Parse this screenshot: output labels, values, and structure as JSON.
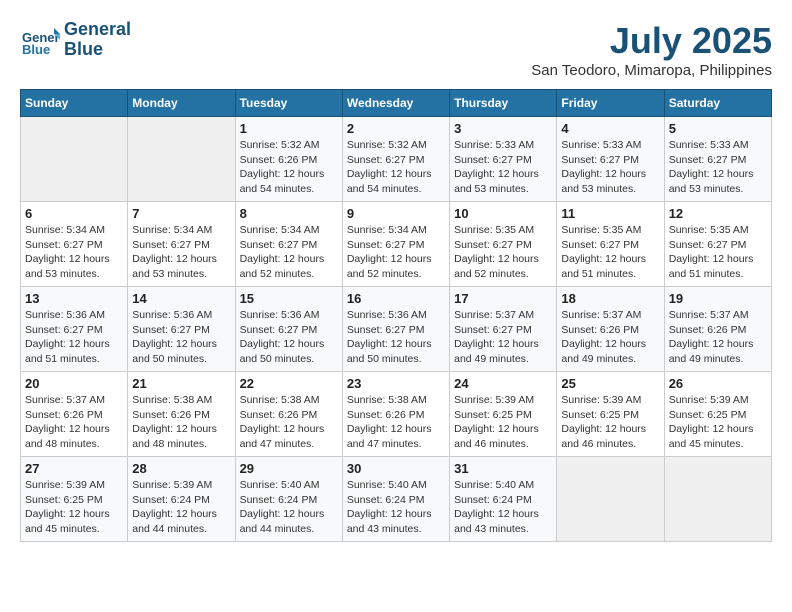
{
  "header": {
    "logo_line1": "General",
    "logo_line2": "Blue",
    "month_title": "July 2025",
    "subtitle": "San Teodoro, Mimaropa, Philippines"
  },
  "days_of_week": [
    "Sunday",
    "Monday",
    "Tuesday",
    "Wednesday",
    "Thursday",
    "Friday",
    "Saturday"
  ],
  "weeks": [
    [
      {
        "day": "",
        "info": ""
      },
      {
        "day": "",
        "info": ""
      },
      {
        "day": "1",
        "info": "Sunrise: 5:32 AM\nSunset: 6:26 PM\nDaylight: 12 hours\nand 54 minutes."
      },
      {
        "day": "2",
        "info": "Sunrise: 5:32 AM\nSunset: 6:27 PM\nDaylight: 12 hours\nand 54 minutes."
      },
      {
        "day": "3",
        "info": "Sunrise: 5:33 AM\nSunset: 6:27 PM\nDaylight: 12 hours\nand 53 minutes."
      },
      {
        "day": "4",
        "info": "Sunrise: 5:33 AM\nSunset: 6:27 PM\nDaylight: 12 hours\nand 53 minutes."
      },
      {
        "day": "5",
        "info": "Sunrise: 5:33 AM\nSunset: 6:27 PM\nDaylight: 12 hours\nand 53 minutes."
      }
    ],
    [
      {
        "day": "6",
        "info": "Sunrise: 5:34 AM\nSunset: 6:27 PM\nDaylight: 12 hours\nand 53 minutes."
      },
      {
        "day": "7",
        "info": "Sunrise: 5:34 AM\nSunset: 6:27 PM\nDaylight: 12 hours\nand 53 minutes."
      },
      {
        "day": "8",
        "info": "Sunrise: 5:34 AM\nSunset: 6:27 PM\nDaylight: 12 hours\nand 52 minutes."
      },
      {
        "day": "9",
        "info": "Sunrise: 5:34 AM\nSunset: 6:27 PM\nDaylight: 12 hours\nand 52 minutes."
      },
      {
        "day": "10",
        "info": "Sunrise: 5:35 AM\nSunset: 6:27 PM\nDaylight: 12 hours\nand 52 minutes."
      },
      {
        "day": "11",
        "info": "Sunrise: 5:35 AM\nSunset: 6:27 PM\nDaylight: 12 hours\nand 51 minutes."
      },
      {
        "day": "12",
        "info": "Sunrise: 5:35 AM\nSunset: 6:27 PM\nDaylight: 12 hours\nand 51 minutes."
      }
    ],
    [
      {
        "day": "13",
        "info": "Sunrise: 5:36 AM\nSunset: 6:27 PM\nDaylight: 12 hours\nand 51 minutes."
      },
      {
        "day": "14",
        "info": "Sunrise: 5:36 AM\nSunset: 6:27 PM\nDaylight: 12 hours\nand 50 minutes."
      },
      {
        "day": "15",
        "info": "Sunrise: 5:36 AM\nSunset: 6:27 PM\nDaylight: 12 hours\nand 50 minutes."
      },
      {
        "day": "16",
        "info": "Sunrise: 5:36 AM\nSunset: 6:27 PM\nDaylight: 12 hours\nand 50 minutes."
      },
      {
        "day": "17",
        "info": "Sunrise: 5:37 AM\nSunset: 6:27 PM\nDaylight: 12 hours\nand 49 minutes."
      },
      {
        "day": "18",
        "info": "Sunrise: 5:37 AM\nSunset: 6:26 PM\nDaylight: 12 hours\nand 49 minutes."
      },
      {
        "day": "19",
        "info": "Sunrise: 5:37 AM\nSunset: 6:26 PM\nDaylight: 12 hours\nand 49 minutes."
      }
    ],
    [
      {
        "day": "20",
        "info": "Sunrise: 5:37 AM\nSunset: 6:26 PM\nDaylight: 12 hours\nand 48 minutes."
      },
      {
        "day": "21",
        "info": "Sunrise: 5:38 AM\nSunset: 6:26 PM\nDaylight: 12 hours\nand 48 minutes."
      },
      {
        "day": "22",
        "info": "Sunrise: 5:38 AM\nSunset: 6:26 PM\nDaylight: 12 hours\nand 47 minutes."
      },
      {
        "day": "23",
        "info": "Sunrise: 5:38 AM\nSunset: 6:26 PM\nDaylight: 12 hours\nand 47 minutes."
      },
      {
        "day": "24",
        "info": "Sunrise: 5:39 AM\nSunset: 6:25 PM\nDaylight: 12 hours\nand 46 minutes."
      },
      {
        "day": "25",
        "info": "Sunrise: 5:39 AM\nSunset: 6:25 PM\nDaylight: 12 hours\nand 46 minutes."
      },
      {
        "day": "26",
        "info": "Sunrise: 5:39 AM\nSunset: 6:25 PM\nDaylight: 12 hours\nand 45 minutes."
      }
    ],
    [
      {
        "day": "27",
        "info": "Sunrise: 5:39 AM\nSunset: 6:25 PM\nDaylight: 12 hours\nand 45 minutes."
      },
      {
        "day": "28",
        "info": "Sunrise: 5:39 AM\nSunset: 6:24 PM\nDaylight: 12 hours\nand 44 minutes."
      },
      {
        "day": "29",
        "info": "Sunrise: 5:40 AM\nSunset: 6:24 PM\nDaylight: 12 hours\nand 44 minutes."
      },
      {
        "day": "30",
        "info": "Sunrise: 5:40 AM\nSunset: 6:24 PM\nDaylight: 12 hours\nand 43 minutes."
      },
      {
        "day": "31",
        "info": "Sunrise: 5:40 AM\nSunset: 6:24 PM\nDaylight: 12 hours\nand 43 minutes."
      },
      {
        "day": "",
        "info": ""
      },
      {
        "day": "",
        "info": ""
      }
    ]
  ]
}
